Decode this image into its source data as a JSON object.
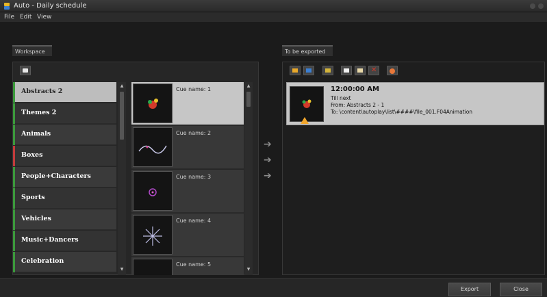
{
  "window": {
    "title": "Auto - Daily schedule"
  },
  "menu": {
    "items": [
      "File",
      "Edit",
      "View"
    ]
  },
  "workspace": {
    "tab_label": "Workspace",
    "categories": [
      {
        "label": "Abstracts 2",
        "selected": true,
        "bar_color": "#3c9a3c"
      },
      {
        "label": "Themes 2",
        "bar_color": "#3c9a3c"
      },
      {
        "label": "Animals",
        "bar_color": "#3c9a3c"
      },
      {
        "label": "Boxes",
        "bar_color": "#c43c3c"
      },
      {
        "label": "People+Characters",
        "bar_color": "#3c9a3c"
      },
      {
        "label": "Sports",
        "bar_color": "#3c9a3c"
      },
      {
        "label": "Vehicles",
        "bar_color": "#3c9a3c"
      },
      {
        "label": "Music+Dancers",
        "bar_color": "#3c9a3c"
      },
      {
        "label": "Celebration",
        "bar_color": "#3c9a3c"
      }
    ],
    "cues": [
      {
        "label": "Cue name: 1",
        "selected": true,
        "thumb_icon": "fireworks-thumbnail-icon"
      },
      {
        "label": "Cue name: 2",
        "thumb_icon": "wave-thumbnail-icon"
      },
      {
        "label": "Cue name: 3",
        "thumb_icon": "sparkle-thumbnail-icon"
      },
      {
        "label": "Cue name: 4",
        "thumb_icon": "starburst-thumbnail-icon"
      },
      {
        "label": "Cue name: 5",
        "thumb_icon": "thumbnail-icon"
      }
    ]
  },
  "export": {
    "tab_label": "To be exported",
    "toolbar_icons": [
      "open-folder-icon",
      "save-icon",
      "add-icon",
      "new-icon",
      "copy-icon",
      "delete-icon",
      "record-icon"
    ],
    "item": {
      "time": "12:00:00 AM",
      "line1": "Till next",
      "line2": "From: Abstracts 2 - 1",
      "line3": "To: \\content\\autoplay\\list\\####\\file_001.F04Animation"
    }
  },
  "buttons": {
    "export_label": "Export",
    "close_label": "Close"
  },
  "colors": {
    "selected_row": "#c6c6c6",
    "category_green": "#3c9a3c",
    "category_red": "#c43c3c",
    "warning": "#f2a62c"
  }
}
